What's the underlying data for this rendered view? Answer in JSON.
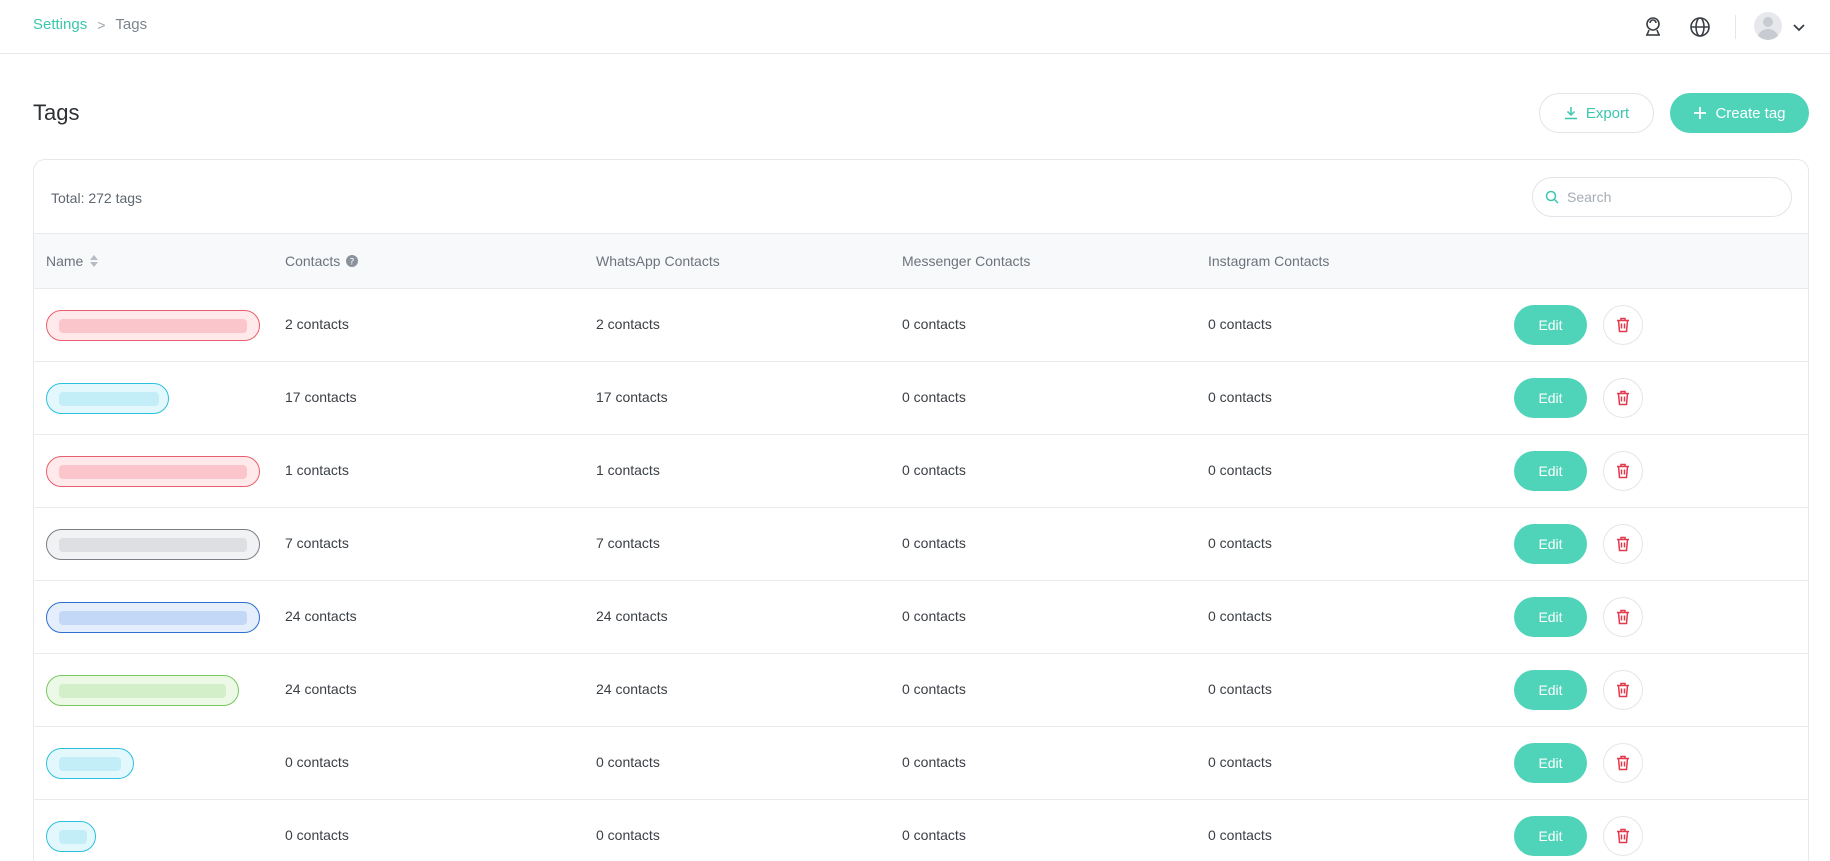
{
  "breadcrumb": {
    "parent": "Settings",
    "separator": ">",
    "current": "Tags"
  },
  "header": {
    "title": "Tags",
    "export_label": "Export",
    "create_label": "Create tag"
  },
  "colors": {
    "accent": "#4fd3b9",
    "accent_text": "#3cc6ae",
    "danger": "#e2394d"
  },
  "summary": {
    "total": "Total: 272 tags"
  },
  "search": {
    "placeholder": "Search"
  },
  "table": {
    "columns": [
      "Name",
      "Contacts",
      "WhatsApp Contacts",
      "Messenger Contacts",
      "Instagram Contacts"
    ],
    "edit_label": "Edit",
    "rows": [
      {
        "tag_color": "red",
        "contacts": "2 contacts",
        "whatsapp": "2 contacts",
        "messenger": "0 contacts",
        "instagram": "0 contacts"
      },
      {
        "tag_color": "cyan",
        "contacts": "17 contacts",
        "whatsapp": "17 contacts",
        "messenger": "0 contacts",
        "instagram": "0 contacts"
      },
      {
        "tag_color": "red",
        "contacts": "1 contacts",
        "whatsapp": "1 contacts",
        "messenger": "0 contacts",
        "instagram": "0 contacts"
      },
      {
        "tag_color": "gray",
        "contacts": "7 contacts",
        "whatsapp": "7 contacts",
        "messenger": "0 contacts",
        "instagram": "0 contacts"
      },
      {
        "tag_color": "blue",
        "contacts": "24 contacts",
        "whatsapp": "24 contacts",
        "messenger": "0 contacts",
        "instagram": "0 contacts"
      },
      {
        "tag_color": "green",
        "contacts": "24 contacts",
        "whatsapp": "24 contacts",
        "messenger": "0 contacts",
        "instagram": "0 contacts"
      },
      {
        "tag_color": "cyan",
        "contacts": "0 contacts",
        "whatsapp": "0 contacts",
        "messenger": "0 contacts",
        "instagram": "0 contacts"
      },
      {
        "tag_color": "cyan",
        "contacts": "0 contacts",
        "whatsapp": "0 contacts",
        "messenger": "0 contacts",
        "instagram": "0 contacts"
      }
    ]
  }
}
